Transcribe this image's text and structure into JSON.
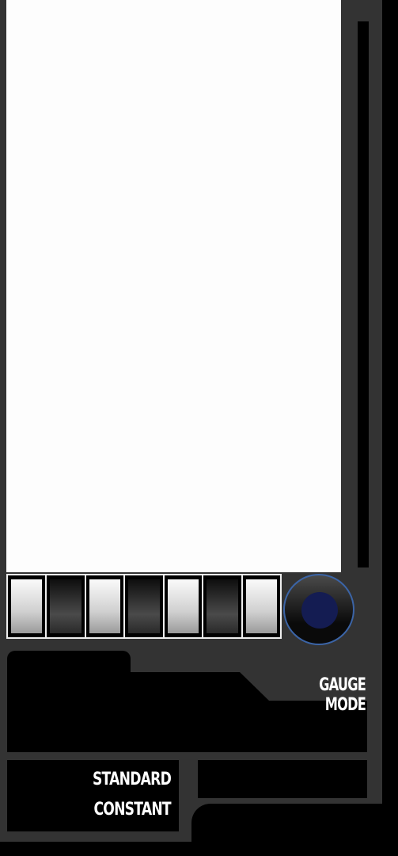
{
  "switches": [
    {
      "state": "on"
    },
    {
      "state": "off"
    },
    {
      "state": "on"
    },
    {
      "state": "off"
    },
    {
      "state": "on"
    },
    {
      "state": "off"
    },
    {
      "state": "on"
    }
  ],
  "gauge_mode_label": "GAUGE MODE",
  "modes": {
    "line1": "STANDARD",
    "line2": "CONSTANT"
  },
  "colors": {
    "panel": "#333333",
    "knob_ring": "#3b64a6",
    "knob_core": "#141c52",
    "screen": "#fdfdfd"
  }
}
